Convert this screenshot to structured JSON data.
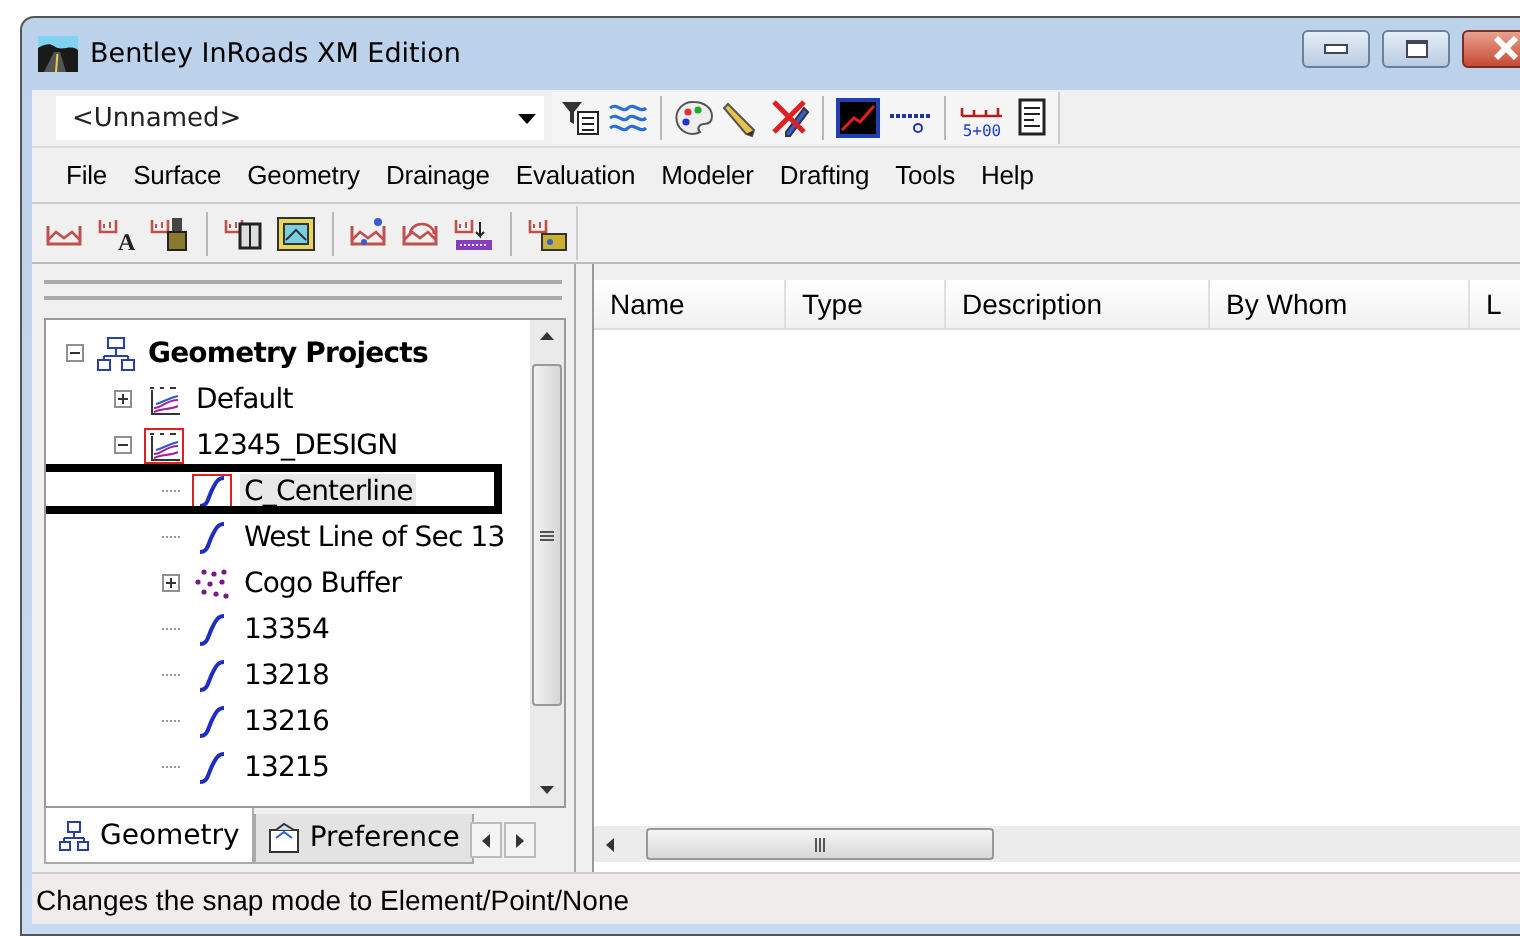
{
  "window": {
    "title": "Bentley InRoads XM Edition"
  },
  "project_selector": {
    "value": "<Unnamed>"
  },
  "toolbar_top": [
    {
      "kind": "filter"
    },
    {
      "kind": "waves"
    },
    {
      "kind": "sep"
    },
    {
      "kind": "palette"
    },
    {
      "kind": "pencil"
    },
    {
      "kind": "crossed-pencil"
    },
    {
      "kind": "sep"
    },
    {
      "kind": "graph"
    },
    {
      "kind": "dash"
    },
    {
      "kind": "sep"
    },
    {
      "kind": "station",
      "label": "5+00"
    },
    {
      "kind": "report"
    }
  ],
  "menu": [
    "File",
    "Surface",
    "Geometry",
    "Drainage",
    "Evaluation",
    "Modeler",
    "Drafting",
    "Tools",
    "Help"
  ],
  "toolbar_sections": [
    {
      "kind": "section"
    },
    {
      "kind": "section-text",
      "label": "A"
    },
    {
      "kind": "section-brush"
    },
    {
      "kind": "sep"
    },
    {
      "kind": "section-panel"
    },
    {
      "kind": "section-picture"
    },
    {
      "kind": "sep"
    },
    {
      "kind": "section-edit"
    },
    {
      "kind": "section-arc"
    },
    {
      "kind": "section-move"
    },
    {
      "kind": "sep"
    },
    {
      "kind": "section-tag"
    }
  ],
  "tree": [
    {
      "label": "Geometry Projects",
      "kind": "root",
      "expanded": true,
      "selected": false,
      "framed": false,
      "children": [
        {
          "label": "Default",
          "kind": "project",
          "expanded": false,
          "selected": false,
          "framed": false
        },
        {
          "label": "12345_DESIGN",
          "kind": "project",
          "expanded": true,
          "selected": false,
          "framed": false,
          "active": true,
          "children": [
            {
              "label": "C_Centerline",
              "kind": "alignment",
              "selected": true,
              "framed": true,
              "active": true
            },
            {
              "label": "West Line of Sec 13",
              "kind": "alignment",
              "selected": false,
              "framed": false,
              "active": false
            },
            {
              "label": "Cogo Buffer",
              "kind": "cogo",
              "expanded": false,
              "selected": false,
              "framed": false,
              "active": false
            },
            {
              "label": "13354",
              "kind": "alignment",
              "selected": false,
              "framed": false,
              "active": false
            },
            {
              "label": "13218",
              "kind": "alignment",
              "selected": false,
              "framed": false,
              "active": false
            },
            {
              "label": "13216",
              "kind": "alignment",
              "selected": false,
              "framed": false,
              "active": false
            },
            {
              "label": "13215",
              "kind": "alignment",
              "selected": false,
              "framed": false,
              "active": false
            }
          ]
        }
      ]
    }
  ],
  "panel_tabs": [
    {
      "label": "Geometry",
      "kind": "geometry",
      "selected": true
    },
    {
      "label": "Preference",
      "kind": "preference",
      "selected": false
    }
  ],
  "list": {
    "columns": [
      "Name",
      "Type",
      "Description",
      "By Whom",
      "L"
    ]
  },
  "status_bar": {
    "text": "Changes the snap mode to Element/Point/None"
  }
}
